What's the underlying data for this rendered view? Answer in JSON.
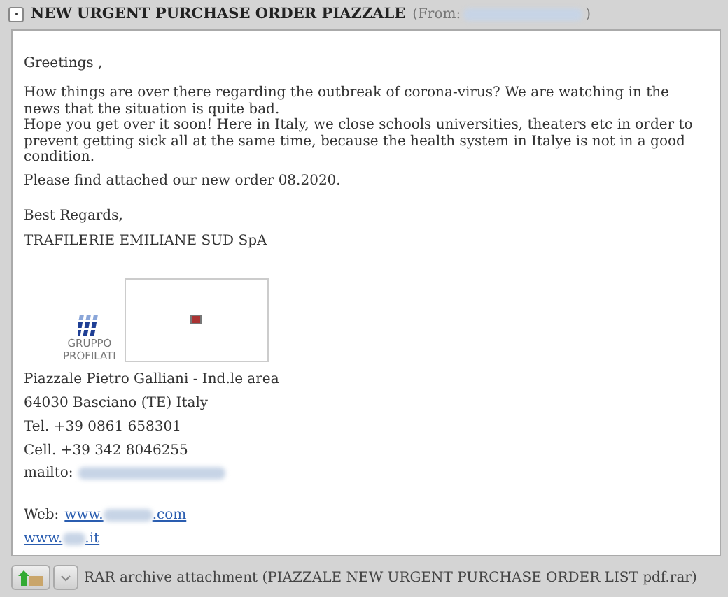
{
  "header": {
    "subject": "NEW URGENT PURCHASE ORDER PIAZZALE",
    "from_label": "(From:",
    "from_close": ")"
  },
  "body": {
    "greeting": "Greetings ,",
    "paragraphs": [
      "How things are over there  regarding the outbreak of corona-virus? We are watching in the news that the situation is quite bad.",
      "Hope you get over it soon! Here in Italy, we close schools universities, theaters etc in order to prevent getting sick all at the same time, because the health system in Italye is not in a good condition."
    ],
    "attachment_note": "Please find attached our new order 08.2020.",
    "closing": "Best Regards,",
    "company": "TRAFILERIE EMILIANE SUD SpA",
    "logo": {
      "line_1": "GRUPPO",
      "line_2": "PROFILATI"
    },
    "address": [
      "Piazzale Pietro Galliani - Ind.le area",
      "64030 Basciano (TE) Italy",
      "Tel. +39 0861 658301",
      "Cell. +39 342 8046255"
    ],
    "mailto_label": "mailto:",
    "web_label": "Web:",
    "links": [
      {
        "prefix": "www.",
        "suffix": ".com"
      },
      {
        "prefix": "www.",
        "suffix": ".it"
      }
    ]
  },
  "attachment": {
    "text": "RAR archive attachment (PIAZZALE NEW URGENT PURCHASE ORDER LIST pdf.rar)"
  }
}
